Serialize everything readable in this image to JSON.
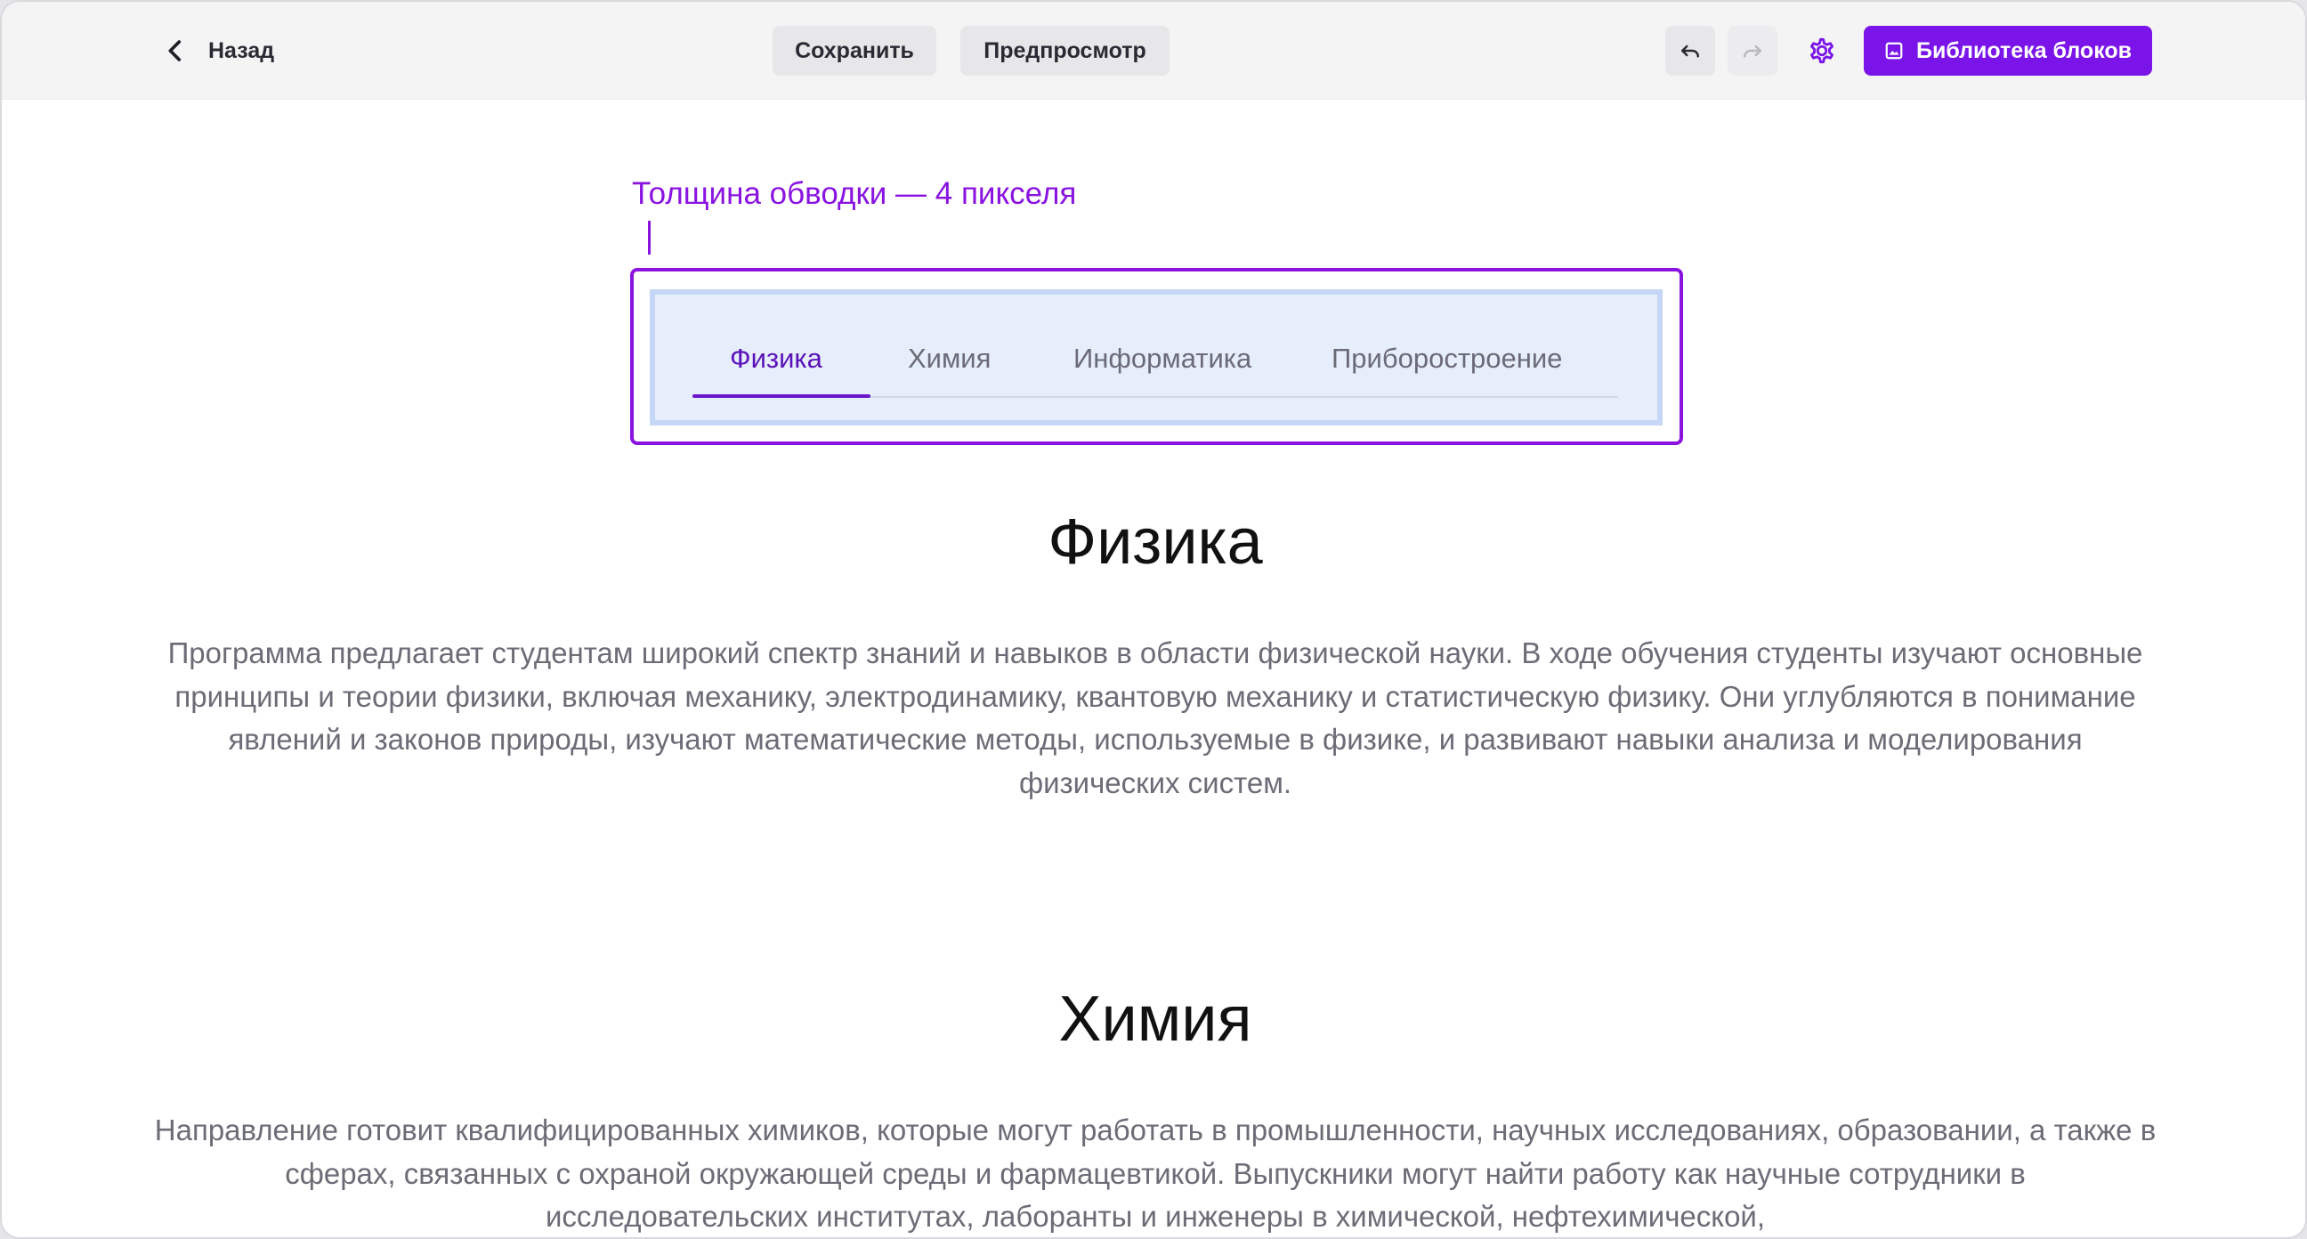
{
  "toolbar": {
    "back_label": "Назад",
    "save_label": "Сохранить",
    "preview_label": "Предпросмотр",
    "library_label": "Библиотека блоков"
  },
  "annotation": {
    "label": "Толщина обводки — 4 пикселя"
  },
  "tabs": {
    "items": [
      {
        "label": "Физика",
        "active": true
      },
      {
        "label": "Химия",
        "active": false
      },
      {
        "label": "Информатика",
        "active": false
      },
      {
        "label": "Приборостроение",
        "active": false
      }
    ]
  },
  "sections": [
    {
      "title": "Физика",
      "text": "Программа предлагает студентам широкий спектр знаний и навыков в области физической науки. В ходе обучения студенты изучают основные принципы и теории физики, включая механику, электродинамику, квантовую механику и статистическую физику. Они углубляются в понимание явлений и законов природы, изучают математические методы, используемые в физике, и развивают навыки анализа и моделирования физических систем."
    },
    {
      "title": "Химия",
      "text": "Направление готовит квалифицированных химиков, которые могут работать в промышленности, научных исследованиях, образовании, а также в сферах, связанных с охраной окружающей среды и фармацевтикой. Выпускники могут найти работу как научные сотрудники в исследовательских институтах, лаборанты и инженеры в химической, нефтехимической,"
    }
  ],
  "colors": {
    "accent": "#7a14e8",
    "annotation": "#8a13e0",
    "tabs_background": "#e6edfb",
    "tabs_border": "#c5d6f6",
    "active_tab": "#5b12b8"
  },
  "icons": {
    "back": "chevron-left-icon",
    "undo": "undo-icon",
    "redo": "redo-icon",
    "settings": "gear-icon",
    "library": "image-icon"
  }
}
